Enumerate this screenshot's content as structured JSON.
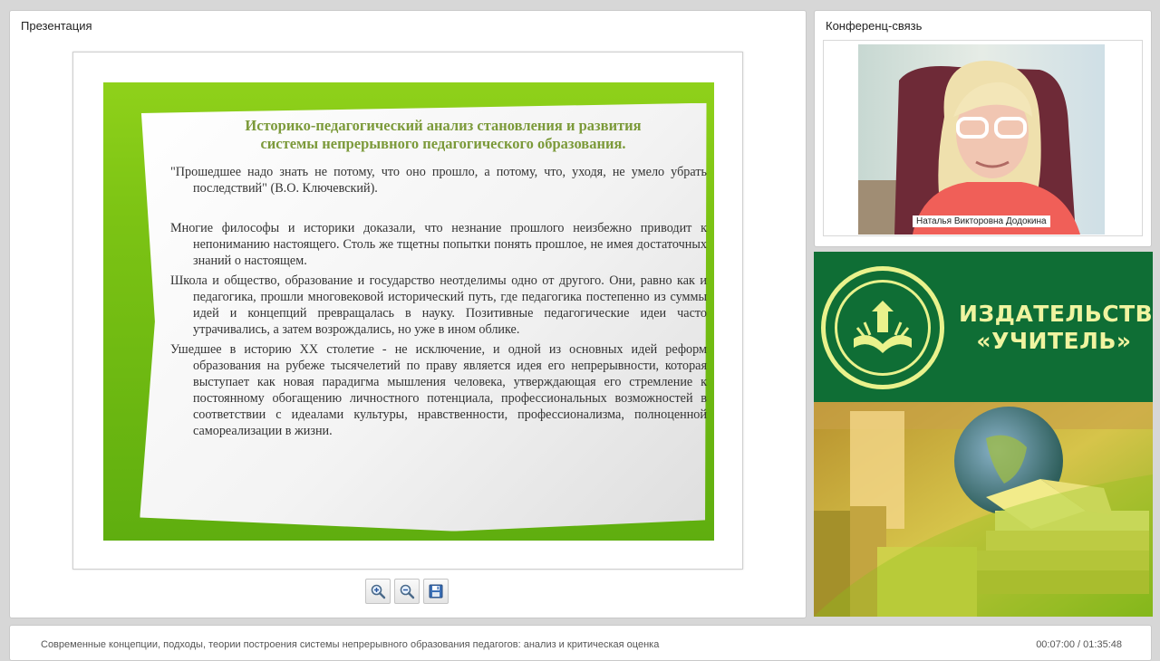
{
  "presentation": {
    "title": "Презентация",
    "slide": {
      "heading_line1": "Историко-педагогический анализ становления и развития",
      "heading_line2": "системы непрерывного педагогического образования.",
      "p1": "\"Прошедшее надо знать не потому, что оно прошло, а потому, что, уходя, не умело убрать последствий\" (В.О. Ключевский).",
      "p2": "Многие философы и историки доказали, что незнание прошлого неизбежно приводит к непониманию настоящего. Столь же тщетны попытки понять прошлое, не имея достаточных знаний о настоящем.",
      "p3": "Школа и общество, образование и государство неотделимы одно от другого. Они, равно как и педагогика, прошли многовековой исторический путь, где педагогика постепенно из суммы идей и концепций превращалась в науку. Позитивные педагогические идеи часто утрачивались, а затем возрождались, но уже в ином облике.",
      "p4": "Ушедшее в историю XX столетие - не исключение, и одной из основных идей реформ образования на рубеже тысячелетий по праву является идея его непрерывности, которая выступает как новая парадигма мышления человека, утверждающая его стремление к постоянному обогащению личностного потенциала, профессиональных возможностей в соответствии с идеалами культуры, нравственности, профессионализма, полноценной самореализации в жизни."
    },
    "toolbar": {
      "zoom_in_icon": "zoom-in-icon",
      "zoom_out_icon": "zoom-out-icon",
      "save_icon": "save-icon"
    }
  },
  "conference": {
    "title": "Конференц-связь",
    "speaker_name": "Наталья Викторовна Додокина"
  },
  "banner": {
    "line1": "ИЗДАТЕЛЬСТВО",
    "line2": "«УЧИТЕЛЬ»"
  },
  "footer": {
    "lecture_title": "Современные концепции, подходы, теории построения системы непрерывного образования педагогов: анализ и критическая оценка",
    "time": "00:07:00 / 01:35:48"
  },
  "colors": {
    "slide_green": "#7cc314",
    "heading_green": "#7c9a3a",
    "banner_green": "#0f6e35",
    "banner_text": "#f0f4a0"
  }
}
